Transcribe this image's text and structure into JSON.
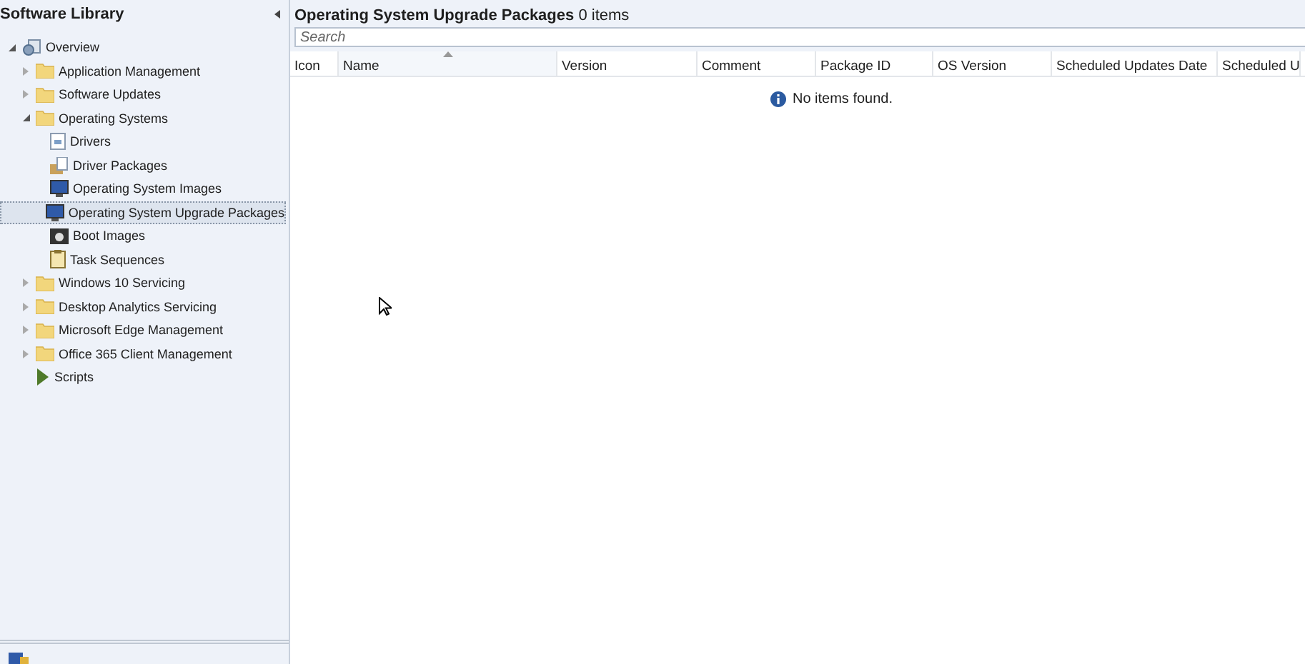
{
  "sidebar": {
    "title": "Software Library",
    "tree": [
      {
        "label": "Overview",
        "kind": "overview",
        "expanded": true,
        "selected": false,
        "children": [
          {
            "label": "Application Management",
            "kind": "folder",
            "expanded": false,
            "selected": false
          },
          {
            "label": "Software Updates",
            "kind": "folder",
            "expanded": false,
            "selected": false
          },
          {
            "label": "Operating Systems",
            "kind": "folder",
            "expanded": true,
            "selected": false,
            "children": [
              {
                "label": "Drivers",
                "kind": "document",
                "selected": false
              },
              {
                "label": "Driver Packages",
                "kind": "package",
                "selected": false
              },
              {
                "label": "Operating System Images",
                "kind": "monitor",
                "selected": false
              },
              {
                "label": "Operating System Upgrade Packages",
                "kind": "monitor",
                "selected": true
              },
              {
                "label": "Boot Images",
                "kind": "disc",
                "selected": false
              },
              {
                "label": "Task Sequences",
                "kind": "clipboard",
                "selected": false
              }
            ]
          },
          {
            "label": "Windows 10 Servicing",
            "kind": "folder",
            "expanded": false,
            "selected": false
          },
          {
            "label": "Desktop Analytics Servicing",
            "kind": "folder",
            "expanded": false,
            "selected": false
          },
          {
            "label": "Microsoft Edge Management",
            "kind": "folder",
            "expanded": false,
            "selected": false
          },
          {
            "label": "Office 365 Client Management",
            "kind": "folder",
            "expanded": false,
            "selected": false
          },
          {
            "label": "Scripts",
            "kind": "play",
            "selected": false
          }
        ]
      }
    ]
  },
  "main": {
    "title": "**Operating System Upgrade Packages** 0 items",
    "search": {
      "placeholder": "Search"
    },
    "table": {
      "columns": [
        {
          "label": "Icon",
          "sorted": false
        },
        {
          "label": "Name",
          "sorted": true
        },
        {
          "label": "Version",
          "sorted": false
        },
        {
          "label": "Comment",
          "sorted": false
        },
        {
          "label": "Package ID",
          "sorted": false
        },
        {
          "label": "OS Version",
          "sorted": false
        },
        {
          "label": "Scheduled Updates Date",
          "sorted": false
        },
        {
          "label": "Scheduled U",
          "sorted": false
        }
      ],
      "empty_message": "No items found."
    }
  }
}
